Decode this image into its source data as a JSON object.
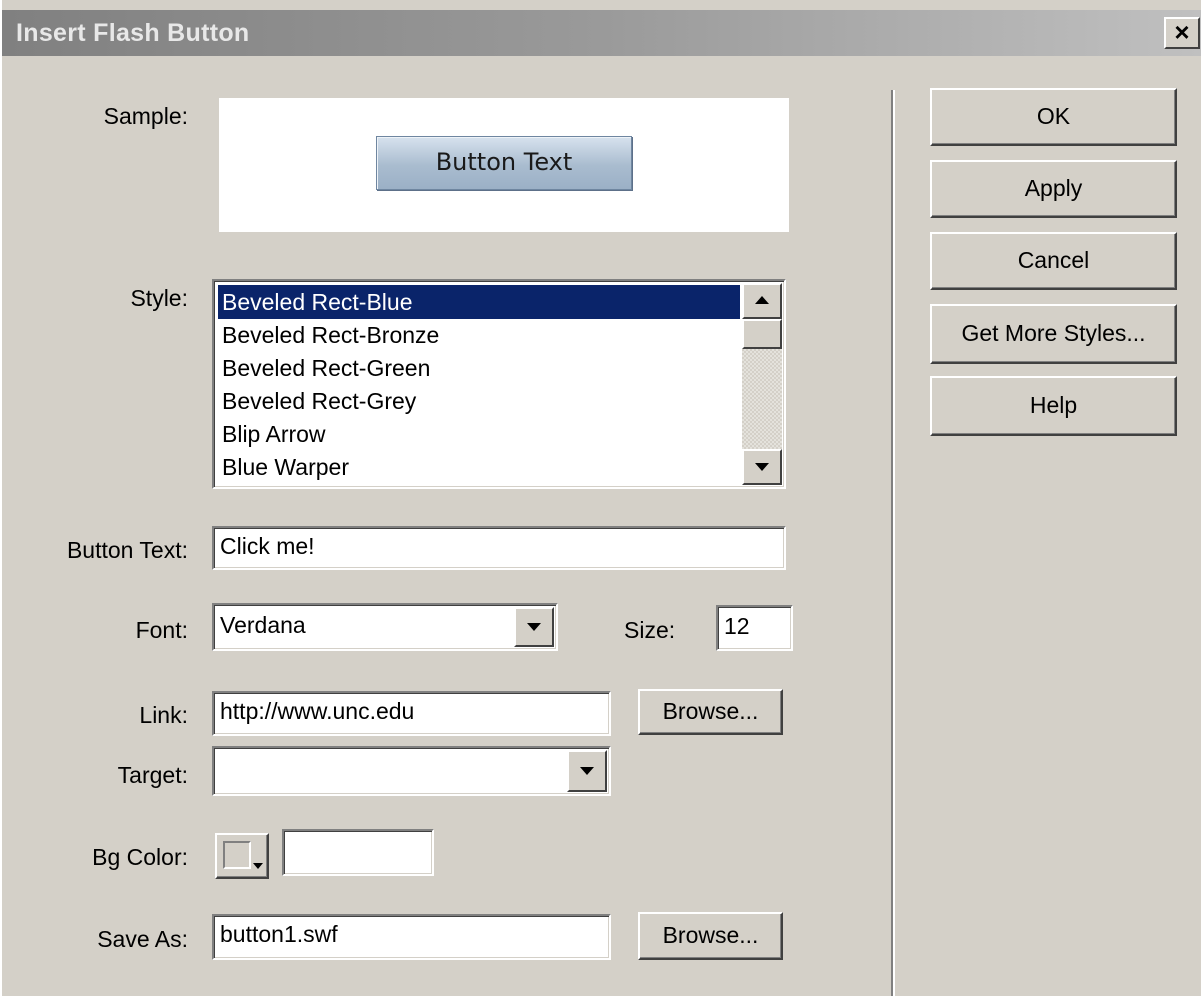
{
  "window": {
    "title": "Insert Flash Button",
    "close_glyph": "×"
  },
  "sample": {
    "label": "Sample:",
    "preview_text": "Button Text"
  },
  "style": {
    "label": "Style:",
    "items": [
      "Beveled Rect-Blue",
      "Beveled Rect-Bronze",
      "Beveled Rect-Green",
      "Beveled Rect-Grey",
      "Blip Arrow",
      "Blue Warper"
    ],
    "selected_index": 0
  },
  "button_text": {
    "label": "Button Text:",
    "value": "Click me!"
  },
  "font": {
    "label": "Font:",
    "value": "Verdana"
  },
  "size": {
    "label": "Size:",
    "value": "12"
  },
  "link": {
    "label": "Link:",
    "value": "http://www.unc.edu",
    "browse_label": "Browse..."
  },
  "target": {
    "label": "Target:",
    "value": ""
  },
  "bg_color": {
    "label": "Bg Color:",
    "value": ""
  },
  "save_as": {
    "label": "Save As:",
    "value": "button1.swf",
    "browse_label": "Browse..."
  },
  "actions": {
    "ok": "OK",
    "apply": "Apply",
    "cancel": "Cancel",
    "more_styles": "Get More Styles...",
    "help": "Help"
  },
  "colors": {
    "selection": "#0a246a",
    "dialog_bg": "#d4d0c8",
    "title_gradient_start": "#808080"
  },
  "icons": {
    "close": "close-icon",
    "dropdown": "chevron-down-icon",
    "scroll_up": "scroll-up-icon",
    "scroll_down": "scroll-down-icon",
    "color_picker": "color-swatch-icon"
  }
}
